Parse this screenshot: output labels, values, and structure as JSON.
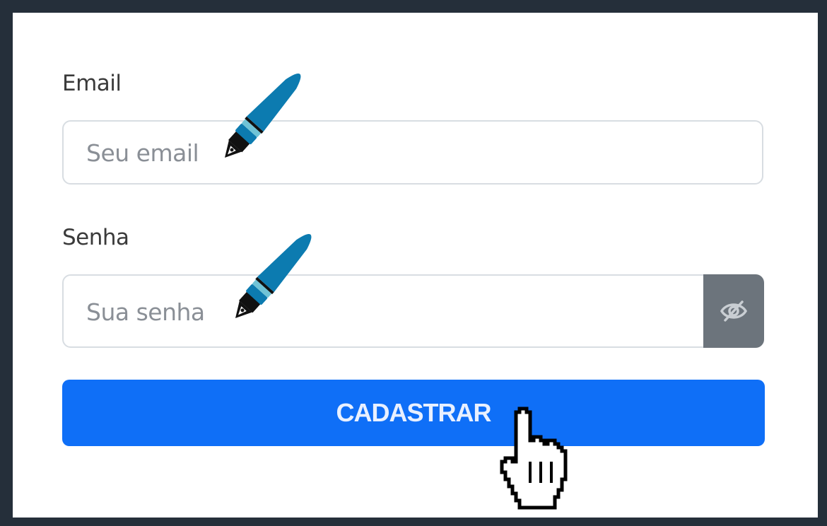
{
  "form": {
    "email_label": "Email",
    "email_placeholder": "Seu email",
    "password_label": "Senha",
    "password_placeholder": "Sua senha",
    "submit_label": "CADASTRAR"
  },
  "icons": {
    "eye_toggle": "eye-slash-icon",
    "pen": "fountain-pen-icon",
    "cursor": "hand-pointer-icon"
  },
  "colors": {
    "frame": "#252f3a",
    "primary": "#0f6ff7",
    "eye_button": "#6c747c",
    "pen_body": "#0c7bb0"
  }
}
